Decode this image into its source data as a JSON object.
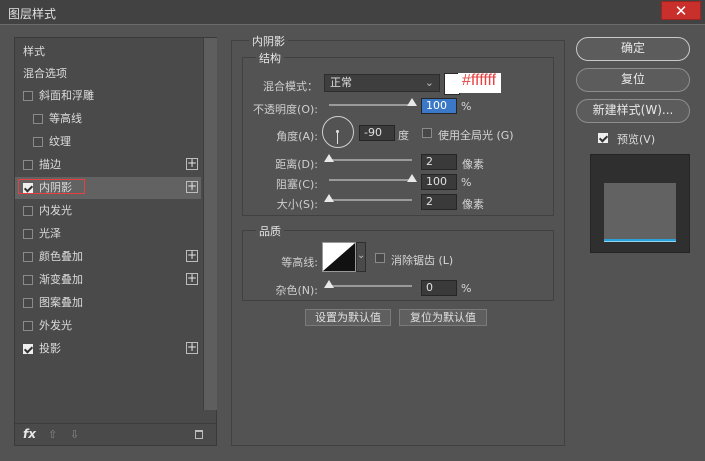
{
  "window": {
    "title": "图层样式",
    "close_glyph": "✕"
  },
  "styles_list": {
    "header": "样式",
    "blend_options": "混合选项",
    "items": [
      {
        "label": "斜面和浮雕",
        "checked": false
      },
      {
        "label": "等高线",
        "checked": false
      },
      {
        "label": "纹理",
        "checked": false
      },
      {
        "label": "描边",
        "checked": false
      },
      {
        "label": "内阴影",
        "checked": true
      },
      {
        "label": "内发光",
        "checked": false
      },
      {
        "label": "光泽",
        "checked": false
      },
      {
        "label": "颜色叠加",
        "checked": false
      },
      {
        "label": "渐变叠加",
        "checked": false
      },
      {
        "label": "图案叠加",
        "checked": false
      },
      {
        "label": "外发光",
        "checked": false
      },
      {
        "label": "投影",
        "checked": true
      }
    ],
    "footer_fx": "fx"
  },
  "inner_shadow": {
    "title": "内阴影",
    "structure": {
      "title": "结构",
      "blend_mode_label": "混合模式：",
      "blend_mode_value": "正常",
      "color_annotation": "#ffffff",
      "opacity_label": "不透明度(O):",
      "opacity_value": "100",
      "opacity_level": 1.0,
      "percent": "%",
      "angle_label": "角度(A):",
      "angle_value": "-90",
      "angle_unit": "度",
      "global_light_label": "使用全局光 (G)",
      "distance_label": "距离(D):",
      "distance_value": "2",
      "distance_unit": "像素",
      "choke_label": "阻塞(C):",
      "choke_value": "100",
      "size_label": "大小(S):",
      "size_value": "2",
      "size_unit": "像素"
    },
    "quality": {
      "title": "品质",
      "contour_label": "等高线:",
      "anti_alias_label": "消除锯齿 (L)",
      "noise_label": "杂色(N):",
      "noise_value": "0"
    },
    "set_default": "设置为默认值",
    "reset_default": "复位为默认值"
  },
  "actions": {
    "ok": "确定",
    "reset": "复位",
    "new_style": "新建样式(W)...",
    "preview_label": "预览(V)"
  },
  "colors": {
    "accent_red": "#e64040",
    "selection_blue": "#3c78c8"
  }
}
